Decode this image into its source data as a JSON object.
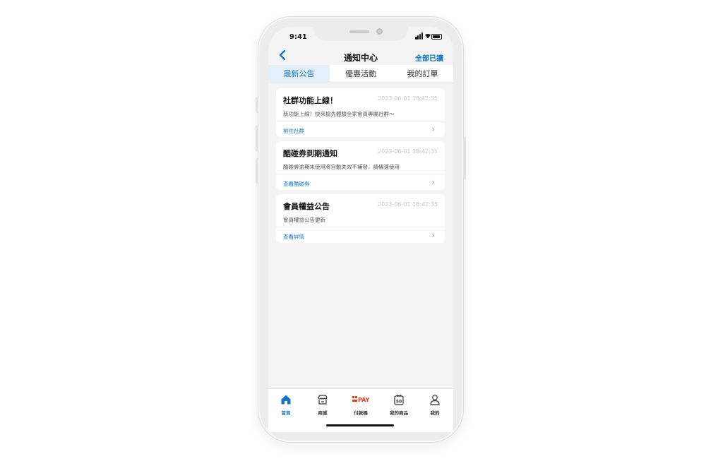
{
  "status": {
    "time": "9:41"
  },
  "header": {
    "back_icon": "chevron-left-icon",
    "title": "通知中心",
    "read_all": "全部已讀"
  },
  "tabs": [
    {
      "label": "最新公告",
      "active": true
    },
    {
      "label": "優惠活動",
      "active": false
    },
    {
      "label": "我的訂單",
      "active": false
    }
  ],
  "notifications": [
    {
      "title": "社群功能上線！",
      "time": "2023-06-01 18:42:35",
      "desc": "新功能上線！快來搶先體驗全家會員專屬社群〜",
      "link": "前往社群"
    },
    {
      "title": "酷碰券到期通知",
      "time": "2023-06-01 18:42:35",
      "desc": "酷碰券逾期未使用將自動失效不補發，請儘速使用",
      "link": "查看酷碰券"
    },
    {
      "title": "會員權益公告",
      "time": "2023-06-01 18:42:35",
      "desc": "會員權益公告更新",
      "link": "查看詳情"
    }
  ],
  "bottom_nav": [
    {
      "label": "首頁",
      "icon": "home-icon",
      "active": true
    },
    {
      "label": "商城",
      "icon": "store-icon",
      "active": false
    },
    {
      "label": "付款碼",
      "icon": "pay-icon",
      "logo_text": "PAY",
      "active": false
    },
    {
      "label": "我的商品",
      "icon": "gift-icon",
      "badge": "50",
      "active": false
    },
    {
      "label": "我的",
      "icon": "user-icon",
      "active": false
    }
  ],
  "colors": {
    "accent": "#1476c8",
    "pay_red": "#e83a1e"
  }
}
